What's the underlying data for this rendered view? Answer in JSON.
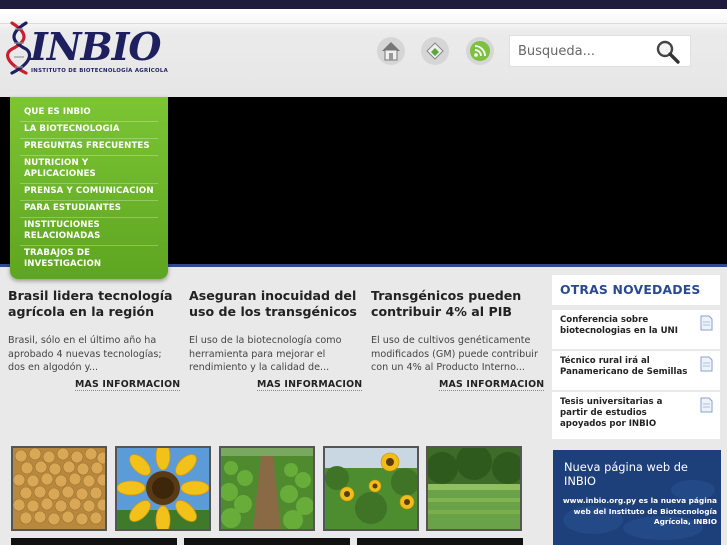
{
  "brand": {
    "logo_text": "INBIO",
    "logo_subtitle": "INSTITUTO DE BIOTECNOLOGÍA AGRÍCOLA"
  },
  "header": {
    "icons": [
      "home-icon",
      "bookmark-icon",
      "rss-icon"
    ],
    "search_placeholder": "Busqueda...",
    "search_icon": "magnifier-icon"
  },
  "menu": {
    "items": [
      {
        "label": "QUE ES INBIO"
      },
      {
        "label": "LA BIOTECNOLOGIA"
      },
      {
        "label": "PREGUNTAS FRECUENTES"
      },
      {
        "label": "NUTRICION Y APLICACIONES"
      },
      {
        "label": "PRENSA Y COMUNICACION"
      },
      {
        "label": "PARA ESTUDIANTES"
      },
      {
        "label": "INSTITUCIONES RELACIONADAS"
      },
      {
        "label": "TRABAJOS DE INVESTIGACION"
      }
    ]
  },
  "news": [
    {
      "title": "Brasil lidera tecnología agrícola en la región",
      "summary": "Brasil, sólo en el último año ha aprobado 4 nuevas tecnologías; dos en algodón y...",
      "more": "MAS INFORMACION"
    },
    {
      "title": "Aseguran inocuidad del uso de los transgénicos",
      "summary": "El uso de la biotecnología como herramienta para mejorar el rendimiento y la calidad de...",
      "more": "MAS INFORMACION"
    },
    {
      "title": "Transgénicos pueden contribuir 4% al PIB",
      "summary": "El uso de cultivos genéticamente modificados (GM) puede contribuir con un 4% al Producto Interno...",
      "more": "MAS INFORMACION"
    }
  ],
  "gallery": [
    {
      "subject": "soybeans-photo"
    },
    {
      "subject": "sunflower-photo"
    },
    {
      "subject": "crop-field-photo"
    },
    {
      "subject": "sunflower-field-photo"
    },
    {
      "subject": "green-field-photo"
    }
  ],
  "sidebar": {
    "title": "OTRAS NOVEDADES",
    "items": [
      {
        "label": "Conferencia sobre biotecnologias en la UNI"
      },
      {
        "label": "Técnico rural irá al Panamericano de Semillas"
      },
      {
        "label": "Tesis universitarias a partir de estudios apoyados por INBIO"
      }
    ]
  },
  "promo": {
    "title": "Nueva página web de INBIO",
    "body": "www.inbio.org.py es la nueva página web del Instituto de Biotecnología Agrícola, INBIO"
  },
  "colors": {
    "accent_green": "#6cb52a",
    "brand_navy": "#1e1f5e",
    "sidebar_blue": "#2a4a8f",
    "promo_blue": "#1d3f7a"
  }
}
